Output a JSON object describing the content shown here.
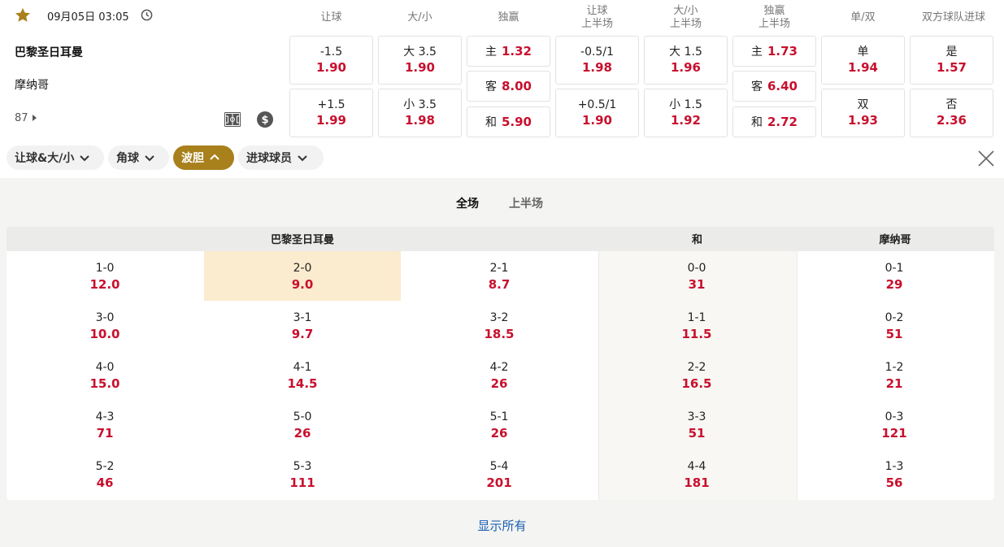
{
  "header": {
    "datetime": "09月05日 03:05",
    "columns": [
      "让球",
      "大/小",
      "独赢",
      "让球\n上半场",
      "大/小\n上半场",
      "独赢\n上半场",
      "单/双",
      "双方球队进球"
    ]
  },
  "match": {
    "home": "巴黎圣日耳曼",
    "away": "摩纳哥",
    "minute": "87"
  },
  "odds": {
    "handicap": [
      {
        "label": "-1.5",
        "odd": "1.90"
      },
      {
        "label": "+1.5",
        "odd": "1.99"
      }
    ],
    "overunder": [
      {
        "label": "大 3.5",
        "odd": "1.90"
      },
      {
        "label": "小 3.5",
        "odd": "1.98"
      }
    ],
    "moneyline": [
      {
        "label": "主",
        "odd": "1.32"
      },
      {
        "label": "客",
        "odd": "8.00"
      },
      {
        "label": "和",
        "odd": "5.90"
      }
    ],
    "handicap_half": [
      {
        "label": "-0.5/1",
        "odd": "1.98"
      },
      {
        "label": "+0.5/1",
        "odd": "1.90"
      }
    ],
    "overunder_half": [
      {
        "label": "大 1.5",
        "odd": "1.96"
      },
      {
        "label": "小 1.5",
        "odd": "1.92"
      }
    ],
    "moneyline_half": [
      {
        "label": "主",
        "odd": "1.73"
      },
      {
        "label": "客",
        "odd": "6.40"
      },
      {
        "label": "和",
        "odd": "2.72"
      }
    ],
    "oddeven": [
      {
        "label": "单",
        "odd": "1.94"
      },
      {
        "label": "双",
        "odd": "1.93"
      }
    ],
    "btts": [
      {
        "label": "是",
        "odd": "1.57"
      },
      {
        "label": "否",
        "odd": "2.36"
      }
    ]
  },
  "tabs": [
    {
      "label": "让球&大/小",
      "active": false
    },
    {
      "label": "角球",
      "active": false
    },
    {
      "label": "波胆",
      "active": true
    },
    {
      "label": "进球球员",
      "active": false
    }
  ],
  "subtabs": [
    {
      "label": "全场",
      "active": true
    },
    {
      "label": "上半场",
      "active": false
    }
  ],
  "table": {
    "headers": {
      "home": "巴黎圣日耳曼",
      "draw": "和",
      "away": "摩纳哥"
    },
    "rows": [
      [
        {
          "s": "1-0",
          "o": "12.0"
        },
        {
          "s": "2-0",
          "o": "9.0",
          "hl": true
        },
        {
          "s": "2-1",
          "o": "8.7"
        },
        {
          "s": "0-0",
          "o": "31"
        },
        {
          "s": "0-1",
          "o": "29"
        }
      ],
      [
        {
          "s": "3-0",
          "o": "10.0"
        },
        {
          "s": "3-1",
          "o": "9.7"
        },
        {
          "s": "3-2",
          "o": "18.5"
        },
        {
          "s": "1-1",
          "o": "11.5"
        },
        {
          "s": "0-2",
          "o": "51"
        }
      ],
      [
        {
          "s": "4-0",
          "o": "15.0"
        },
        {
          "s": "4-1",
          "o": "14.5"
        },
        {
          "s": "4-2",
          "o": "26"
        },
        {
          "s": "2-2",
          "o": "16.5"
        },
        {
          "s": "1-2",
          "o": "21"
        }
      ],
      [
        {
          "s": "4-3",
          "o": "71"
        },
        {
          "s": "5-0",
          "o": "26"
        },
        {
          "s": "5-1",
          "o": "26"
        },
        {
          "s": "3-3",
          "o": "51"
        },
        {
          "s": "0-3",
          "o": "121"
        }
      ],
      [
        {
          "s": "5-2",
          "o": "46"
        },
        {
          "s": "5-3",
          "o": "111"
        },
        {
          "s": "5-4",
          "o": "201"
        },
        {
          "s": "4-4",
          "o": "181"
        },
        {
          "s": "1-3",
          "o": "56"
        }
      ]
    ]
  },
  "show_all": "显示所有",
  "colors": {
    "odd": "#c8102e",
    "accent": "#a8801c",
    "highlight": "#fbebcf",
    "link": "#1a5fb4"
  },
  "icons": [
    "star-icon",
    "clock-icon",
    "pitch-icon",
    "dollar-icon",
    "caret-right-icon",
    "chevron-down-icon",
    "chevron-up-icon",
    "close-icon"
  ]
}
